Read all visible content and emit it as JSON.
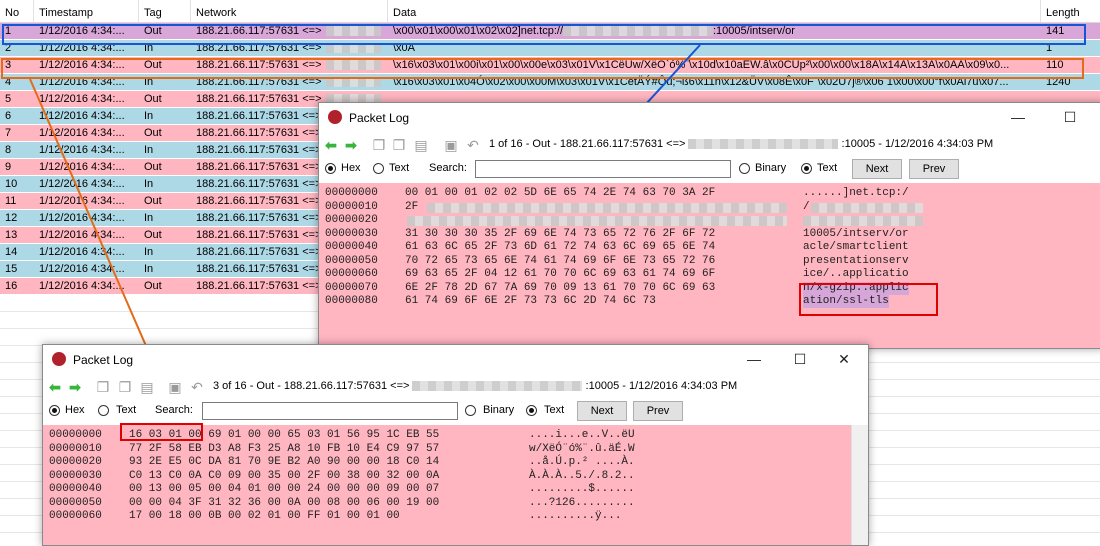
{
  "columns": {
    "no": "No",
    "timestamp": "Timestamp",
    "tag": "Tag",
    "network": "Network",
    "data": "Data",
    "length": "Length"
  },
  "rows": [
    {
      "no": "1",
      "ts": "1/12/2016 4:34:...",
      "tag": "Out",
      "net": "188.21.66.117:57631 <=>",
      "data_a": "\\x00\\x01\\x00\\x01\\x02\\x02]net.tcp://",
      "data_b": ":10005/intserv/or",
      "len": "141"
    },
    {
      "no": "2",
      "ts": "1/12/2016 4:34:...",
      "tag": "In",
      "net": "188.21.66.117:57631 <=>",
      "data_a": "\\x0A",
      "data_b": "",
      "len": "1"
    },
    {
      "no": "3",
      "ts": "1/12/2016 4:34:...",
      "tag": "Out",
      "net": "188.21.66.117:57631 <=>",
      "data_a": "\\x16\\x03\\x01\\x00i\\x01\\x00\\x00e\\x03\\x01V\\x1CëUw/XëÕ`ó%¨\\x10d\\x10aÉW.â\\x0CÜp²\\x00\\x00\\x18À\\x14À\\x13À\\x0AÀ\\x09\\x0...",
      "data_b": "",
      "len": "110"
    },
    {
      "no": "4",
      "ts": "1/12/2016 4:34:...",
      "tag": "In",
      "net": "188.21.66.117:57631 <=>",
      "data_a": "\\x16\\x03\\x01\\x04Ó\\x02\\x00\\x00M\\x03\\x01V\\x1CëtÄÝ#Ôû;¬ß6\\x11ñ\\x12&ÜV\\x08Ê\\x0F¨\\x02U7j®\\x06 1\\x00\\x00°f\\x0Al7u\\x07...",
      "data_b": "",
      "len": "1240"
    },
    {
      "no": "5",
      "ts": "1/12/2016 4:34:...",
      "tag": "Out",
      "net": "188.21.66.117:57631 <=>",
      "data_a": "",
      "data_b": "",
      "len": ""
    },
    {
      "no": "6",
      "ts": "1/12/2016 4:34:...",
      "tag": "In",
      "net": "188.21.66.117:57631 <=>",
      "data_a": "",
      "data_b": "",
      "len": ""
    },
    {
      "no": "7",
      "ts": "1/12/2016 4:34:...",
      "tag": "Out",
      "net": "188.21.66.117:57631 <=>",
      "data_a": "",
      "data_b": "",
      "len": ""
    },
    {
      "no": "8",
      "ts": "1/12/2016 4:34:...",
      "tag": "In",
      "net": "188.21.66.117:57631 <=>",
      "data_a": "",
      "data_b": "",
      "len": ""
    },
    {
      "no": "9",
      "ts": "1/12/2016 4:34:...",
      "tag": "Out",
      "net": "188.21.66.117:57631 <=>",
      "data_a": "",
      "data_b": "",
      "len": ""
    },
    {
      "no": "10",
      "ts": "1/12/2016 4:34:...",
      "tag": "In",
      "net": "188.21.66.117:57631 <=>",
      "data_a": "",
      "data_b": "",
      "len": ""
    },
    {
      "no": "11",
      "ts": "1/12/2016 4:34:...",
      "tag": "Out",
      "net": "188.21.66.117:57631 <=>",
      "data_a": "",
      "data_b": "",
      "len": ""
    },
    {
      "no": "12",
      "ts": "1/12/2016 4:34:...",
      "tag": "In",
      "net": "188.21.66.117:57631 <=>",
      "data_a": "",
      "data_b": "",
      "len": ""
    },
    {
      "no": "13",
      "ts": "1/12/2016 4:34:...",
      "tag": "Out",
      "net": "188.21.66.117:57631 <=>",
      "data_a": "",
      "data_b": "",
      "len": ""
    },
    {
      "no": "14",
      "ts": "1/12/2016 4:34:...",
      "tag": "In",
      "net": "188.21.66.117:57631 <=>",
      "data_a": "",
      "data_b": "",
      "len": ""
    },
    {
      "no": "15",
      "ts": "1/12/2016 4:34:...",
      "tag": "In",
      "net": "188.21.66.117:57631 <=>",
      "data_a": "",
      "data_b": "",
      "len": ""
    },
    {
      "no": "16",
      "ts": "1/12/2016 4:34:...",
      "tag": "Out",
      "net": "188.21.66.117:57631 <=>",
      "data_a": "",
      "data_b": "",
      "len": ""
    }
  ],
  "win1": {
    "title": "Packet Log",
    "info_a": "1 of 16 - Out - 188.21.66.117:57631 <=>",
    "info_b": ":10005 - 1/12/2016 4:34:03 PM",
    "hex": "Hex",
    "text": "Text",
    "search": "Search:",
    "binary": "Binary",
    "text2": "Text",
    "next": "Next",
    "prev": "Prev",
    "lines": [
      {
        "off": "00000000",
        "hex": "00 01 00 01 02 02 5D 6E 65 74 2E 74 63 70 3A 2F",
        "asc": "......]net.tcp:/"
      },
      {
        "off": "00000010",
        "hex": "2F",
        "asc": "/"
      },
      {
        "off": "00000020",
        "hex": "",
        "asc": ""
      },
      {
        "off": "00000030",
        "hex": "31 30 30 30 35 2F 69 6E 74 73 65 72 76 2F 6F 72",
        "asc": "10005/intserv/or"
      },
      {
        "off": "00000040",
        "hex": "61 63 6C 65 2F 73 6D 61 72 74 63 6C 69 65 6E 74",
        "asc": "acle/smartclient"
      },
      {
        "off": "00000050",
        "hex": "70 72 65 73 65 6E 74 61 74 69 6F 6E 73 65 72 76",
        "asc": "presentationserv"
      },
      {
        "off": "00000060",
        "hex": "69 63 65 2F 04 12 61 70 70 6C 69 63 61 74 69 6F",
        "asc": "ice/..applicatio"
      },
      {
        "off": "00000070",
        "hex": "6E 2F 78 2D 67 7A 69 70 09 13 61 70 70 6C 69 63",
        "asc": "n/x-gzip..applic"
      },
      {
        "off": "00000080",
        "hex": "61 74 69 6F 6E 2F 73 73 6C 2D 74 6C 73",
        "asc": "ation/ssl-tls"
      }
    ]
  },
  "win2": {
    "title": "Packet Log",
    "info_a": "3 of 16 - Out - 188.21.66.117:57631 <=>",
    "info_b": ":10005 - 1/12/2016 4:34:03 PM",
    "hex": "Hex",
    "text": "Text",
    "search": "Search:",
    "binary": "Binary",
    "text2": "Text",
    "next": "Next",
    "prev": "Prev",
    "lines": [
      {
        "off": "00000000",
        "hex": "16 03 01 00 69 01 00 00 65 03 01 56 95 1C EB 55",
        "asc": "....i...e..V..ëU"
      },
      {
        "off": "00000010",
        "hex": "77 2F 58 EB D3 A8 F3 25 A8 10 FB 10 E4 C9 97 57",
        "asc": "w/XëÓ¨ó%¨.û.äÉ.W"
      },
      {
        "off": "00000020",
        "hex": "93 2E E5 0C DA 81 70 9E B2 A0 90 00 00 18 C0 14",
        "asc": "..å.Ú.p.² ....À."
      },
      {
        "off": "00000030",
        "hex": "C0 13 C0 0A C0 09 00 35 00 2F 00 38 00 32 00 0A",
        "asc": "À.À.À..5./.8.2.."
      },
      {
        "off": "00000040",
        "hex": "00 13 00 05 00 04 01 00 00 24 00 00 00 09 00 07",
        "asc": ".........$......"
      },
      {
        "off": "00000050",
        "hex": "00 00 04 3F 31 32 36 00 0A 00 08 00 06 00 19 00",
        "asc": "...?126........."
      },
      {
        "off": "00000060",
        "hex": "17 00 18 00 0B 00 02 01 00 FF 01 00 01 00",
        "asc": "..........ÿ..."
      }
    ]
  },
  "colors": {
    "out": "#ffb6c1",
    "in": "#add8e6",
    "selected": "#d8a6d8",
    "blue_callout": "#1655d4",
    "orange_callout": "#e46b1a",
    "red_callout": "#e00000"
  },
  "icons": [
    "back-arrow-icon",
    "forward-arrow-icon",
    "copy-icon",
    "copy-text-icon",
    "document-icon",
    "save-icon",
    "undo-icon",
    "app-icon"
  ]
}
